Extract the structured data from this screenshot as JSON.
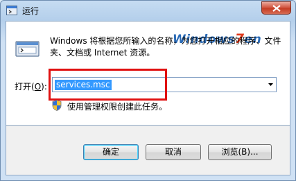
{
  "window": {
    "title": "运行",
    "icon": "run-icon",
    "close_icon": "close-icon"
  },
  "watermark": {
    "prefix": "Windows",
    "seven": "7",
    "suffix": "en"
  },
  "description": "Windows 将根据您所输入的名称，为您打开相应的程序、文件夹、文档或 Internet 资源。",
  "open": {
    "label_prefix": "打开(",
    "label_key": "O",
    "label_suffix": "):",
    "value": "services.msc"
  },
  "admin_note": "使用管理权限创建此任务。",
  "buttons": {
    "ok": "确定",
    "cancel": "取消",
    "browse": "浏览(B)..."
  },
  "colors": {
    "highlight_box": "#e01010",
    "selection": "#3399ff",
    "close_button": "#c43a22"
  }
}
